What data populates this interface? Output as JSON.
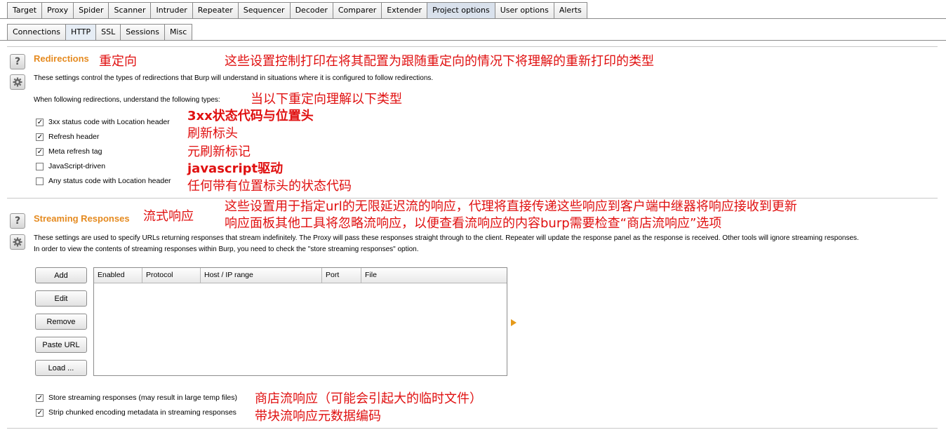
{
  "top_tabs": [
    "Target",
    "Proxy",
    "Spider",
    "Scanner",
    "Intruder",
    "Repeater",
    "Sequencer",
    "Decoder",
    "Comparer",
    "Extender",
    "Project options",
    "User options",
    "Alerts"
  ],
  "top_active": "Project options",
  "sub_tabs": [
    "Connections",
    "HTTP",
    "SSL",
    "Sessions",
    "Misc"
  ],
  "sub_active": "HTTP",
  "redirections": {
    "title": "Redirections",
    "title_cn": "重定向",
    "header_cn": "这些设置控制打印在将其配置为跟随重定向的情况下将理解的重新打印的类型",
    "desc": "These settings control the types of redirections that Burp will understand in situations where it is configured to follow redirections.",
    "sub_label": "When following redirections, understand the following types:",
    "sub_label_cn": "当以下重定向理解以下类型",
    "options": [
      {
        "label": "3xx status code with Location header",
        "checked": true,
        "cn": "3xx状态代码与位置头"
      },
      {
        "label": "Refresh header",
        "checked": true,
        "cn": "刷新标头"
      },
      {
        "label": "Meta refresh tag",
        "checked": true,
        "cn": "元刷新标记"
      },
      {
        "label": "JavaScript-driven",
        "checked": false,
        "cn": "javascript驱动"
      },
      {
        "label": "Any status code with Location header",
        "checked": false,
        "cn": "任何带有位置标头的状态代码"
      }
    ]
  },
  "streaming": {
    "title": "Streaming Responses",
    "title_cn": "流式响应",
    "header_cn_1": "这些设置用于指定url的无限延迟流的响应，代理将直接传递这些响应到客户端中继器将响应接收到更新",
    "header_cn_2": "响应面板其他工具将忽略流响应，以便查看流响应的内容burp需要检查“商店流响应”选项",
    "desc_1": "These settings are used to specify URLs returning responses that stream indefinitely. The Proxy will pass these responses straight through to the client. Repeater will update the response panel as the response is received. Other tools will ignore streaming responses.",
    "desc_2": "In order to view the contents of streaming responses within Burp, you need to check the \"store streaming responses\" option.",
    "buttons": {
      "add": "Add",
      "edit": "Edit",
      "remove": "Remove",
      "paste_url": "Paste URL",
      "load": "Load ..."
    },
    "columns": [
      "Enabled",
      "Protocol",
      "Host / IP range",
      "Port",
      "File"
    ],
    "options": [
      {
        "label": "Store streaming responses (may result in large temp files)",
        "checked": true,
        "cn": "商店流响应（可能会引起大的临时文件）"
      },
      {
        "label": "Strip chunked encoding metadata in streaming responses",
        "checked": true,
        "cn": "带块流响应元数据编码"
      }
    ]
  },
  "icons": {
    "help": "help-icon",
    "settings": "gear-icon"
  }
}
